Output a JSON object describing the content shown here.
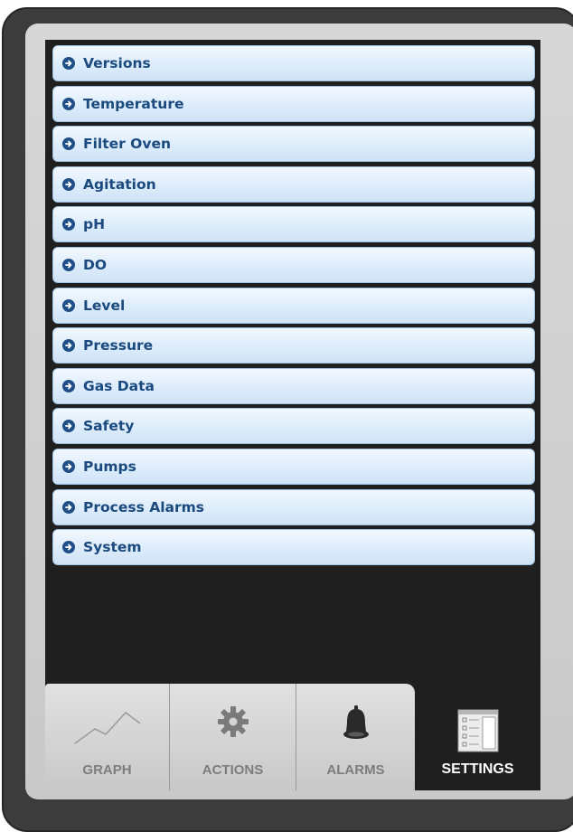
{
  "menu": {
    "items": [
      {
        "label": "Versions"
      },
      {
        "label": "Temperature"
      },
      {
        "label": "Filter Oven"
      },
      {
        "label": "Agitation"
      },
      {
        "label": "pH"
      },
      {
        "label": "DO"
      },
      {
        "label": "Level"
      },
      {
        "label": "Pressure"
      },
      {
        "label": "Gas Data"
      },
      {
        "label": "Safety"
      },
      {
        "label": "Pumps"
      },
      {
        "label": "Process Alarms"
      },
      {
        "label": "System"
      }
    ],
    "item_icon": "arrow-circle-right-icon"
  },
  "tabs": [
    {
      "label": "GRAPH",
      "icon": "line-graph-icon",
      "active": false
    },
    {
      "label": "ACTIONS",
      "icon": "gear-icon",
      "active": false
    },
    {
      "label": "ALARMS",
      "icon": "bell-icon",
      "active": false
    },
    {
      "label": "SETTINGS",
      "icon": "settings-panel-icon",
      "active": true
    }
  ],
  "colors": {
    "item_text": "#1b4a7f",
    "item_background": "#dcecfb",
    "screen_background": "#1f1f1f",
    "active_tab_text": "#ffffff",
    "inactive_tab_text": "#7d7d7d"
  }
}
